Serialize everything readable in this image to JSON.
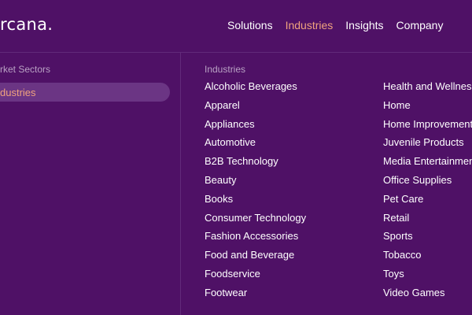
{
  "header": {
    "logo_text": "rcana.",
    "nav": [
      {
        "label": "Solutions",
        "active": false
      },
      {
        "label": "Industries",
        "active": true
      },
      {
        "label": "Insights",
        "active": false
      },
      {
        "label": "Company",
        "active": false
      }
    ]
  },
  "sidebar": {
    "heading": "rket Sectors",
    "selected_item": "dustries"
  },
  "menu": {
    "heading": "Industries",
    "left_column": [
      "Alcoholic Beverages",
      "Apparel",
      "Appliances",
      "Automotive",
      "B2B Technology",
      "Beauty",
      "Books",
      "Consumer Technology",
      "Fashion Accessories",
      "Food and Beverage",
      "Foodservice",
      "Footwear"
    ],
    "right_column": [
      "Health and Wellness",
      "Home",
      "Home Improvement",
      "Juvenile Products",
      "Media Entertainment",
      "Office Supplies",
      "Pet Care",
      "Retail",
      "Sports",
      "Tobacco",
      "Toys",
      "Video Games"
    ]
  },
  "colors": {
    "background": "#4f1166",
    "accent": "#f0a37e",
    "muted_text": "#b9a2c4",
    "selected_pill": "#6b3584"
  }
}
